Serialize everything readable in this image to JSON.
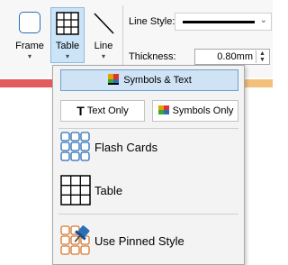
{
  "ribbon": {
    "tools": [
      {
        "label": "Frame",
        "arrow": "▾",
        "icon": "frame-icon"
      },
      {
        "label": "Table",
        "arrow": "▾",
        "icon": "table-icon",
        "active": true
      },
      {
        "label": "Line",
        "arrow": "▾",
        "icon": "line-icon"
      }
    ],
    "line_style_label": "Line Style:",
    "thickness_label": "Thickness:",
    "thickness_value": "0.80mm",
    "dropdown_arrow": "⌄",
    "spin_up": "▲",
    "spin_down": "▼"
  },
  "menu": {
    "symbols_text": "Symbols & Text",
    "text_only": "Text Only",
    "text_only_glyph": "T",
    "symbols_only": "Symbols Only",
    "items": [
      {
        "label": "Flash Cards",
        "icon": "flash-cards-icon"
      },
      {
        "label": "Table",
        "icon": "table-grid-icon"
      },
      {
        "label": "Use Pinned Style",
        "icon": "pinned-style-icon"
      }
    ]
  },
  "colors": {
    "accent_blue": "#2a6fb7",
    "highlight": "#cfe3f5",
    "red_band": "#e35b5b",
    "orange_band": "#f3c07c"
  }
}
